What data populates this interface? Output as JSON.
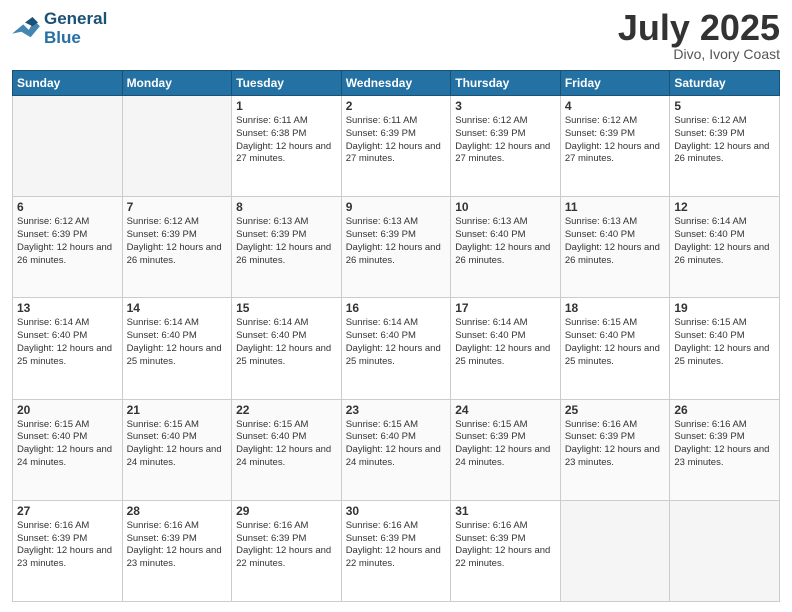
{
  "header": {
    "logo_line1": "General",
    "logo_line2": "Blue",
    "month_title": "July 2025",
    "location": "Divo, Ivory Coast"
  },
  "days_of_week": [
    "Sunday",
    "Monday",
    "Tuesday",
    "Wednesday",
    "Thursday",
    "Friday",
    "Saturday"
  ],
  "weeks": [
    [
      {
        "day": "",
        "info": ""
      },
      {
        "day": "",
        "info": ""
      },
      {
        "day": "1",
        "info": "Sunrise: 6:11 AM\nSunset: 6:38 PM\nDaylight: 12 hours and 27 minutes."
      },
      {
        "day": "2",
        "info": "Sunrise: 6:11 AM\nSunset: 6:39 PM\nDaylight: 12 hours and 27 minutes."
      },
      {
        "day": "3",
        "info": "Sunrise: 6:12 AM\nSunset: 6:39 PM\nDaylight: 12 hours and 27 minutes."
      },
      {
        "day": "4",
        "info": "Sunrise: 6:12 AM\nSunset: 6:39 PM\nDaylight: 12 hours and 27 minutes."
      },
      {
        "day": "5",
        "info": "Sunrise: 6:12 AM\nSunset: 6:39 PM\nDaylight: 12 hours and 26 minutes."
      }
    ],
    [
      {
        "day": "6",
        "info": "Sunrise: 6:12 AM\nSunset: 6:39 PM\nDaylight: 12 hours and 26 minutes."
      },
      {
        "day": "7",
        "info": "Sunrise: 6:12 AM\nSunset: 6:39 PM\nDaylight: 12 hours and 26 minutes."
      },
      {
        "day": "8",
        "info": "Sunrise: 6:13 AM\nSunset: 6:39 PM\nDaylight: 12 hours and 26 minutes."
      },
      {
        "day": "9",
        "info": "Sunrise: 6:13 AM\nSunset: 6:39 PM\nDaylight: 12 hours and 26 minutes."
      },
      {
        "day": "10",
        "info": "Sunrise: 6:13 AM\nSunset: 6:40 PM\nDaylight: 12 hours and 26 minutes."
      },
      {
        "day": "11",
        "info": "Sunrise: 6:13 AM\nSunset: 6:40 PM\nDaylight: 12 hours and 26 minutes."
      },
      {
        "day": "12",
        "info": "Sunrise: 6:14 AM\nSunset: 6:40 PM\nDaylight: 12 hours and 26 minutes."
      }
    ],
    [
      {
        "day": "13",
        "info": "Sunrise: 6:14 AM\nSunset: 6:40 PM\nDaylight: 12 hours and 25 minutes."
      },
      {
        "day": "14",
        "info": "Sunrise: 6:14 AM\nSunset: 6:40 PM\nDaylight: 12 hours and 25 minutes."
      },
      {
        "day": "15",
        "info": "Sunrise: 6:14 AM\nSunset: 6:40 PM\nDaylight: 12 hours and 25 minutes."
      },
      {
        "day": "16",
        "info": "Sunrise: 6:14 AM\nSunset: 6:40 PM\nDaylight: 12 hours and 25 minutes."
      },
      {
        "day": "17",
        "info": "Sunrise: 6:14 AM\nSunset: 6:40 PM\nDaylight: 12 hours and 25 minutes."
      },
      {
        "day": "18",
        "info": "Sunrise: 6:15 AM\nSunset: 6:40 PM\nDaylight: 12 hours and 25 minutes."
      },
      {
        "day": "19",
        "info": "Sunrise: 6:15 AM\nSunset: 6:40 PM\nDaylight: 12 hours and 25 minutes."
      }
    ],
    [
      {
        "day": "20",
        "info": "Sunrise: 6:15 AM\nSunset: 6:40 PM\nDaylight: 12 hours and 24 minutes."
      },
      {
        "day": "21",
        "info": "Sunrise: 6:15 AM\nSunset: 6:40 PM\nDaylight: 12 hours and 24 minutes."
      },
      {
        "day": "22",
        "info": "Sunrise: 6:15 AM\nSunset: 6:40 PM\nDaylight: 12 hours and 24 minutes."
      },
      {
        "day": "23",
        "info": "Sunrise: 6:15 AM\nSunset: 6:40 PM\nDaylight: 12 hours and 24 minutes."
      },
      {
        "day": "24",
        "info": "Sunrise: 6:15 AM\nSunset: 6:39 PM\nDaylight: 12 hours and 24 minutes."
      },
      {
        "day": "25",
        "info": "Sunrise: 6:16 AM\nSunset: 6:39 PM\nDaylight: 12 hours and 23 minutes."
      },
      {
        "day": "26",
        "info": "Sunrise: 6:16 AM\nSunset: 6:39 PM\nDaylight: 12 hours and 23 minutes."
      }
    ],
    [
      {
        "day": "27",
        "info": "Sunrise: 6:16 AM\nSunset: 6:39 PM\nDaylight: 12 hours and 23 minutes."
      },
      {
        "day": "28",
        "info": "Sunrise: 6:16 AM\nSunset: 6:39 PM\nDaylight: 12 hours and 23 minutes."
      },
      {
        "day": "29",
        "info": "Sunrise: 6:16 AM\nSunset: 6:39 PM\nDaylight: 12 hours and 22 minutes."
      },
      {
        "day": "30",
        "info": "Sunrise: 6:16 AM\nSunset: 6:39 PM\nDaylight: 12 hours and 22 minutes."
      },
      {
        "day": "31",
        "info": "Sunrise: 6:16 AM\nSunset: 6:39 PM\nDaylight: 12 hours and 22 minutes."
      },
      {
        "day": "",
        "info": ""
      },
      {
        "day": "",
        "info": ""
      }
    ]
  ]
}
